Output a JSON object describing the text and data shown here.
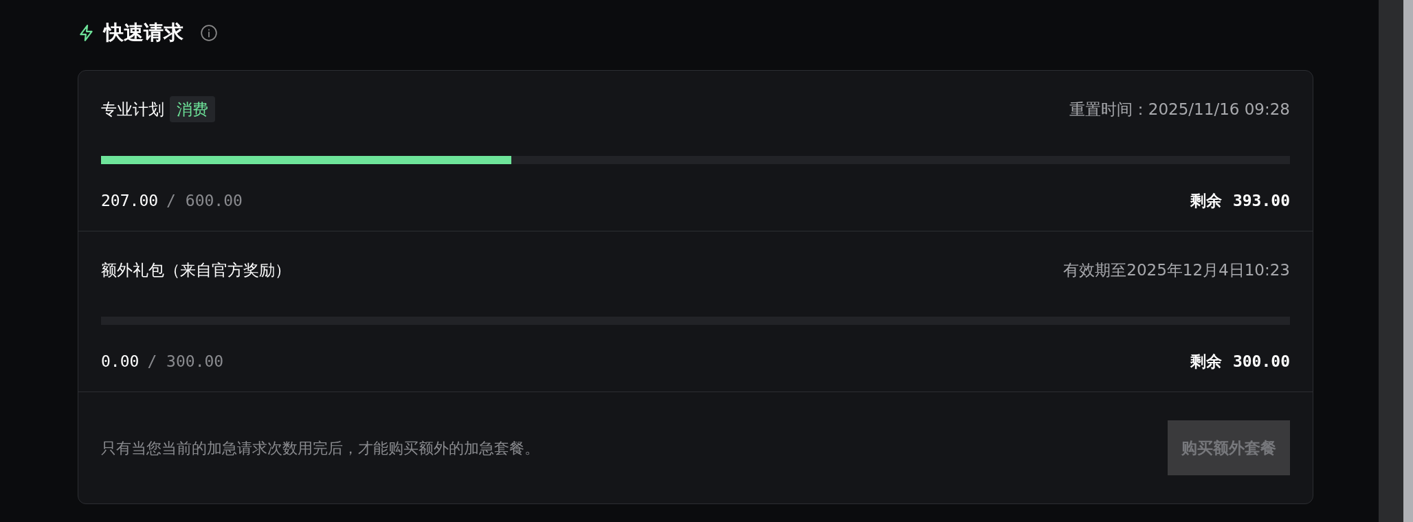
{
  "section": {
    "title": "快速请求"
  },
  "plans": [
    {
      "name": "专业计划",
      "badge": "消费",
      "meta": "重置时间：2025/11/16 09:28",
      "level": 0.345,
      "used": "207.00",
      "total": "/ 600.00",
      "remaining_label": "剩余",
      "remaining": "393.00"
    },
    {
      "name": "额外礼包（来自官方奖励）",
      "meta": "有效期至2025年12月4日10:23",
      "level": 0,
      "used": "0.00",
      "total": "/ 300.00",
      "remaining_label": "剩余",
      "remaining": "300.00"
    }
  ],
  "footer": {
    "note": "只有当您当前的加急请求次数用完后，才能购买额外的加急套餐。",
    "button": {
      "label": "购买额外套餐",
      "disabled": true
    }
  }
}
